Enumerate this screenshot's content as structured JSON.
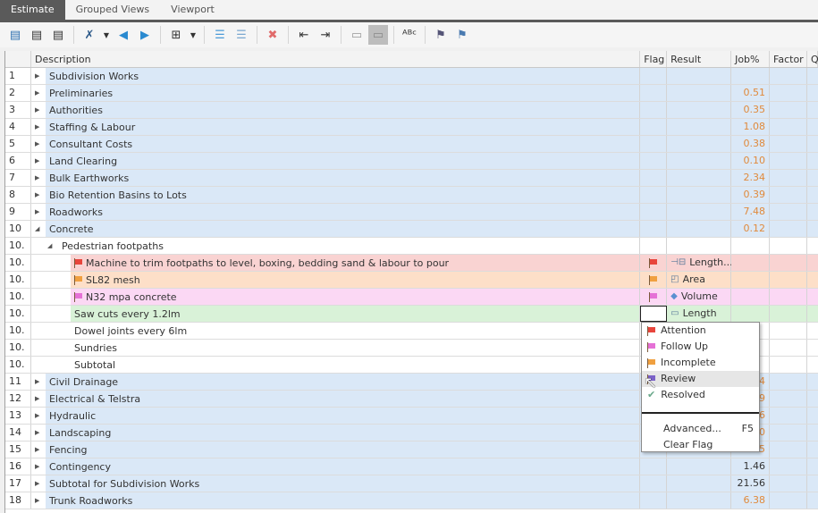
{
  "tabs": [
    {
      "label": "Estimate",
      "active": true
    },
    {
      "label": "Grouped Views"
    },
    {
      "label": "Viewport"
    }
  ],
  "toolbar": [
    "layout-1-icon",
    "layout-2-icon",
    "layout-3-icon",
    "|",
    "tools-icon",
    "v",
    "previous-icon",
    "next-icon",
    "|",
    "tree-icon",
    "v",
    "|",
    "insert-above-icon",
    "insert-below-icon",
    "|",
    "delete-icon",
    "|",
    "outdent-icon",
    "indent-icon",
    "|",
    "group-icon",
    "ungroup-icon",
    "|",
    "spell-check-icon",
    "|",
    "flag-pin-icon",
    "flag-redo-icon"
  ],
  "columns": {
    "num": "",
    "description": "Description",
    "flag": "Flag",
    "result": "Result",
    "job": "Job%",
    "factor": "Factor",
    "q": "Q"
  },
  "colors": {
    "blue": "#dae8f7",
    "red": "#f9d3d2",
    "orange": "#fddfc8",
    "pink": "#fbd8f4",
    "green": "#d9f2d8",
    "attention": "#e8453c",
    "follow_up": "#e571d6",
    "incomplete": "#f0a040",
    "review": "#7b62c8",
    "resolved": "#6aa88a"
  },
  "rows": [
    {
      "num": "1",
      "desc": "Subdivision Works",
      "level": 1,
      "job": ""
    },
    {
      "num": "2",
      "desc": "Preliminaries",
      "level": 1,
      "job": "0.51"
    },
    {
      "num": "3",
      "desc": "Authorities",
      "level": 1,
      "job": "0.35"
    },
    {
      "num": "4",
      "desc": "Staffing & Labour",
      "level": 1,
      "job": "1.08"
    },
    {
      "num": "5",
      "desc": "Consultant Costs",
      "level": 1,
      "job": "0.38"
    },
    {
      "num": "6",
      "desc": "Land Clearing",
      "level": 1,
      "job": "0.10"
    },
    {
      "num": "7",
      "desc": "Bulk Earthworks",
      "level": 1,
      "job": "2.34"
    },
    {
      "num": "8",
      "desc": "Bio Retention Basins to Lots",
      "level": 1,
      "job": "0.39"
    },
    {
      "num": "9",
      "desc": "Roadworks",
      "level": 1,
      "job": "7.48"
    },
    {
      "num": "10",
      "desc": "Concrete",
      "level": 1,
      "job": "0.12",
      "expanded": true
    },
    {
      "num": "10.",
      "desc": "Pedestrian footpaths",
      "level": 2,
      "job": "",
      "expanded": true
    },
    {
      "num": "10.",
      "desc": "Machine to trim footpaths to level, boxing, bedding sand & labour to pour",
      "level": 3,
      "bg": "red",
      "flag": "attention",
      "result": "Length...",
      "result_icon": "length-dims-icon",
      "job": ""
    },
    {
      "num": "10.",
      "desc": "SL82 mesh",
      "level": 3,
      "bg": "orange",
      "flag": "incomplete",
      "result": "Area",
      "result_icon": "area-icon",
      "job": ""
    },
    {
      "num": "10.",
      "desc": "N32 mpa concrete",
      "level": 3,
      "bg": "pink",
      "flag": "follow_up",
      "result": "Volume",
      "result_icon": "volume-icon",
      "job": ""
    },
    {
      "num": "10.",
      "desc": "Saw cuts every 1.2lm",
      "level": 3,
      "bg": "green",
      "result": "Length",
      "result_icon": "length-icon",
      "job": "",
      "editing": true
    },
    {
      "num": "10.",
      "desc": "Dowel joints every 6lm",
      "level": 3,
      "job": ""
    },
    {
      "num": "10.",
      "desc": "Sundries",
      "level": 3,
      "job": ""
    },
    {
      "num": "10.",
      "desc": "Subtotal",
      "level": 3,
      "job": ""
    },
    {
      "num": "11",
      "desc": "Civil Drainage",
      "level": 1,
      "job": "1.74"
    },
    {
      "num": "12",
      "desc": "Electrical & Telstra",
      "level": 1,
      "job": "0.29"
    },
    {
      "num": "13",
      "desc": "Hydraulic",
      "level": 1,
      "job": "0.36"
    },
    {
      "num": "14",
      "desc": "Landscaping",
      "level": 1,
      "job": "0.40"
    },
    {
      "num": "15",
      "desc": "Fencing",
      "level": 1,
      "job": "0.25"
    },
    {
      "num": "16",
      "desc": "Contingency",
      "level": 1,
      "job": "1.46",
      "job_dark": true
    },
    {
      "num": "17",
      "desc": "Subtotal for Subdivision Works",
      "level": 1,
      "job": "21.56",
      "job_dark": true
    },
    {
      "num": "18",
      "desc": "Trunk Roadworks",
      "level": 1,
      "job": "6.38"
    }
  ],
  "flag_menu": {
    "items": [
      {
        "label": "Attention",
        "icon": "attention"
      },
      {
        "label": "Follow Up",
        "icon": "follow_up"
      },
      {
        "label": "Incomplete",
        "icon": "incomplete"
      },
      {
        "label": "Review",
        "icon": "review",
        "highlighted": true
      },
      {
        "label": "Resolved",
        "icon": "resolved"
      }
    ],
    "advanced": "Advanced...",
    "advanced_shortcut": "F5",
    "clear": "Clear Flag"
  }
}
